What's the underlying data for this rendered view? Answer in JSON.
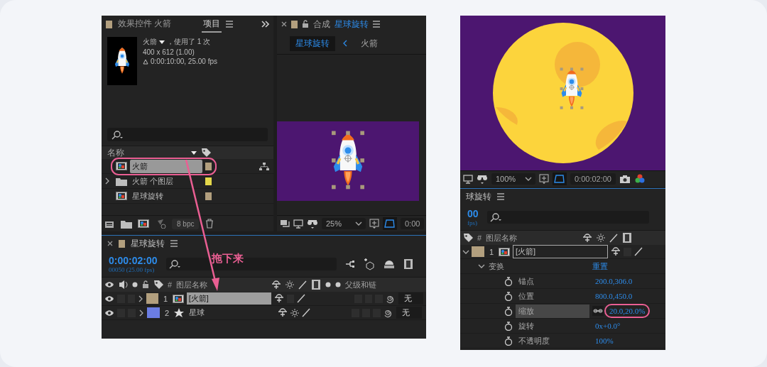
{
  "project_panel": {
    "tabs": [
      {
        "label": "效果控件 火箭",
        "selected": false
      },
      {
        "label": "项目",
        "selected": true
      }
    ],
    "footage": {
      "name": "火箭",
      "usage": "，使用了 1 次",
      "size": "400 x 612 (1.00)",
      "duration": "0:00:10:00, 25.00 fps"
    },
    "name_column": "名称",
    "items": [
      {
        "kind": "comp",
        "name": "火箭",
        "color": "#b29f7e",
        "selected": true,
        "highlighted": true
      },
      {
        "kind": "folder",
        "name": "火箭 个图层",
        "color": "#e3d74a",
        "selected": false,
        "highlighted": false,
        "expanded": false
      },
      {
        "kind": "comp",
        "name": "星球旋转",
        "color": "#b29f7e",
        "selected": false,
        "highlighted": false
      }
    ],
    "bit_depth": "8 bpc"
  },
  "comp_viewer": {
    "label": "合成",
    "comp_name": "星球旋转",
    "breadcrumbs": [
      {
        "label": "星球旋转",
        "selected": true
      },
      {
        "label": "火箭",
        "selected": false
      }
    ],
    "zoom": "25%",
    "timecode": "0:00"
  },
  "timeline": {
    "comp_name": "星球旋转",
    "timecode": "0:00:02:00",
    "frame_info": "00050 (25.00 fps)",
    "columns": {
      "number": "#",
      "layer_name": "图层名称",
      "parent": "父级和链"
    },
    "layers": [
      {
        "kind": "comp",
        "index": "1",
        "name": "[火箭]",
        "color": "#b29f7e",
        "selected": true,
        "parent": "无"
      },
      {
        "kind": "shape",
        "index": "2",
        "name": "星球",
        "color": "#6b7de3",
        "selected": false,
        "parent": "无"
      }
    ]
  },
  "annotation": {
    "label": "拖下来"
  },
  "preview": {
    "zoom": "100%",
    "timecode": "0:00:02:00"
  },
  "timeline_detail": {
    "comp_name": "球旋转",
    "timecode": "00",
    "frame_info": "fps)",
    "columns": {
      "number": "#",
      "layer_name": "图层名称"
    },
    "layer": {
      "index": "1",
      "name": "[火箭]",
      "color": "#b29f7e",
      "expanded": true
    },
    "group": {
      "label": "变换",
      "expanded": true,
      "reset": "重置"
    },
    "properties": [
      {
        "label": "锚点",
        "value": "200.0,306.0",
        "selected": false,
        "highlighted": false
      },
      {
        "label": "位置",
        "value": "800.0,450.0",
        "selected": false,
        "highlighted": false
      },
      {
        "label": "缩放",
        "value": "20.0,20.0%",
        "selected": true,
        "highlighted": true
      },
      {
        "label": "旋转",
        "value": "0x+0.0°",
        "selected": false,
        "highlighted": false
      },
      {
        "label": "不透明度",
        "value": "100%",
        "selected": false,
        "highlighted": false
      }
    ]
  }
}
